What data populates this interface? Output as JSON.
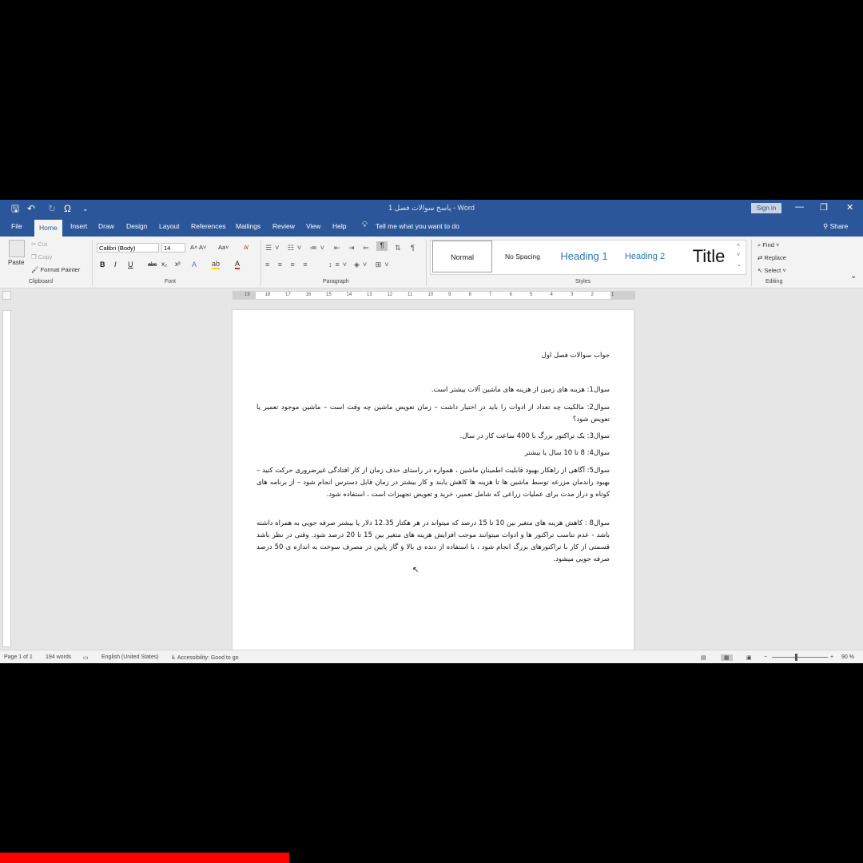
{
  "titlebar": {
    "doc_title": "پاسخ سوالات فصل 1  -  Word",
    "sign_in": "Sign in",
    "quick_access": {
      "save": "🖫",
      "undo": "↶",
      "redo": "↻",
      "omega": "Ω",
      "customize": "⌄"
    },
    "window_controls": {
      "minimize": "—",
      "restore": "❐",
      "close": "✕"
    }
  },
  "tabs": [
    "File",
    "Home",
    "Insert",
    "Draw",
    "Design",
    "Layout",
    "References",
    "Mailings",
    "Review",
    "View",
    "Help"
  ],
  "tell_me": "Tell me what you want to do",
  "share": "Share",
  "ribbon": {
    "clipboard": {
      "paste": "Paste",
      "cut": "Cut",
      "copy": "Copy",
      "format_painter": "Format Painter",
      "label": "Clipboard"
    },
    "font": {
      "name": "Calibri (Body)",
      "size": "14",
      "bold": "B",
      "italic": "I",
      "underline": "U",
      "strike": "abc",
      "subscript": "x₂",
      "superscript": "x²",
      "label": "Font"
    },
    "paragraph": {
      "label": "Paragraph"
    },
    "styles": {
      "items": [
        "Normal",
        "No Spacing",
        "Heading 1",
        "Heading 2",
        "Title"
      ],
      "label": "Styles"
    },
    "editing": {
      "find": "Find",
      "replace": "Replace",
      "select": "Select",
      "label": "Editing"
    }
  },
  "ruler_numbers": [
    "19",
    "18",
    "17",
    "16",
    "15",
    "14",
    "13",
    "12",
    "11",
    "10",
    "9",
    "8",
    "7",
    "6",
    "5",
    "4",
    "3",
    "2",
    "1"
  ],
  "document": {
    "title": "جواب سوالات فصل اول",
    "paragraphs": [
      "سوال1: هزینه های زمین از هزینه های ماشین آلات بیشتر است.",
      "سوال2: مالکیت چه تعداد از ادوات را باید در اختیار داشت – زمان تعویض ماشین چه وقت است – ماشین موجود تعمیر یا تعویض شود؟",
      "سوال3: یک تراکتور بزرگ با 400 ساعت کار در سال.",
      "سوال4: 8 تا 10 سال یا بیشتر",
      "سوال5: آگاهی از راهکار بهبود قابلیت اطمینان ماشین ، همواره در راستای حذف زمان از کار افتادگی غیرضروری حرکت کنید – بهبود راندمان مزرعه توسط ماشین ها تا هزینه ها کاهش یابند و کار بیشتر در زمان قابل دسترس انجام شود – از برنامه های کوتاه و دراز مدت برای عملیات زراعی که شامل تعمیر، خرید و تعویض تجهیزات است ، استفاده شود.",
      "سوال8 : کاهش هزینه های متغیر بین 10 تا 15 درصد که میتواند در هر هکتار 12.35 دلار یا بیشتر صرفه جویی به همراه داشته باشد - عدم تناسب تراکتور ها و ادوات میتوانند موجب افزایش هزینه های متغیر بین 15 تا 20 درصد شود. وقتی در نظر باشد قسمتی از کار با تراکتورهای بزرگ انجام شود ، با استفاده از دنده ی بالا و گاز پایین در مصرف سوخت به اندازه ی 50 درصد صرفه جویی میشود."
    ]
  },
  "statusbar": {
    "page": "Page 1 of 1",
    "words": "194 words",
    "language": "English (United States)",
    "accessibility": "Accessibility: Good to go",
    "zoom": "90 %",
    "zoom_minus": "−",
    "zoom_plus": "+"
  },
  "colors": {
    "word_blue": "#2b579a",
    "progress_red": "#ff0000"
  }
}
